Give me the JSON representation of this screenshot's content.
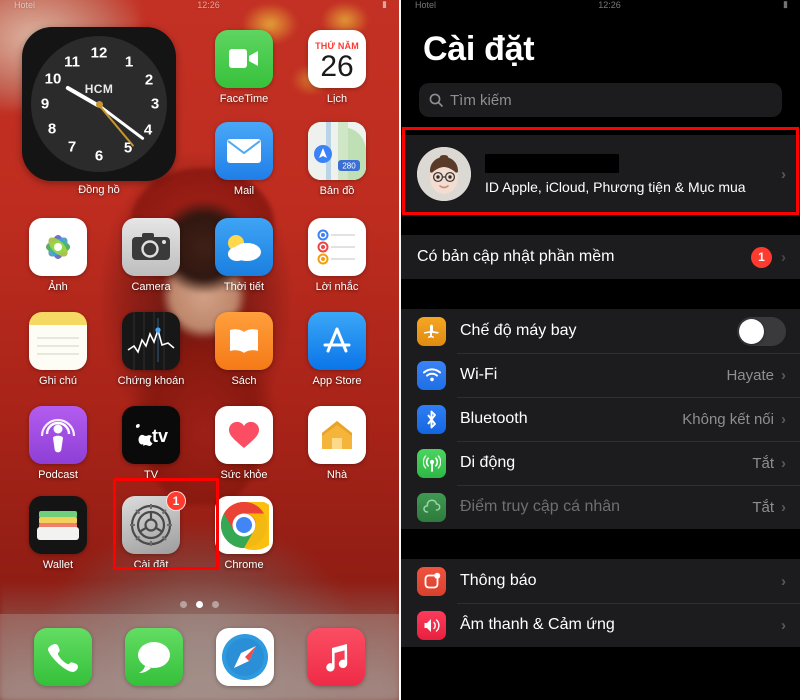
{
  "left_screen": {
    "name": "ios-home-screen",
    "statusbar": {
      "carrier": "Hotel",
      "time": "12:26",
      "battery": ""
    },
    "clock_widget": {
      "city": "HCM",
      "label": "Đồng hồ",
      "numbers": [
        "12",
        "1",
        "2",
        "3",
        "4",
        "5",
        "6",
        "7",
        "8",
        "9",
        "10",
        "11"
      ]
    },
    "apps": [
      {
        "label": "FaceTime",
        "icon": "facetime-icon"
      },
      {
        "label": "Lịch",
        "icon": "calendar-icon",
        "cal_weekday": "THỨ NĂM",
        "cal_day": "26"
      },
      {
        "label": "Mail",
        "icon": "mail-icon"
      },
      {
        "label": "Bản đồ",
        "icon": "maps-icon",
        "route": "280"
      },
      {
        "label": "Ảnh",
        "icon": "photos-icon"
      },
      {
        "label": "Camera",
        "icon": "camera-icon"
      },
      {
        "label": "Thời tiết",
        "icon": "weather-icon"
      },
      {
        "label": "Lời nhắc",
        "icon": "reminders-icon"
      },
      {
        "label": "Ghi chú",
        "icon": "notes-icon"
      },
      {
        "label": "Chứng khoán",
        "icon": "stocks-icon"
      },
      {
        "label": "Sách",
        "icon": "books-icon"
      },
      {
        "label": "App Store",
        "icon": "appstore-icon"
      },
      {
        "label": "Podcast",
        "icon": "podcast-icon"
      },
      {
        "label": "TV",
        "icon": "tv-icon"
      },
      {
        "label": "Sức khỏe",
        "icon": "health-icon"
      },
      {
        "label": "Nhà",
        "icon": "home-icon"
      },
      {
        "label": "Wallet",
        "icon": "wallet-icon"
      },
      {
        "label": "Cài đặt",
        "icon": "settings-gear-icon",
        "badge": "1",
        "highlighted": true
      },
      {
        "label": "Chrome",
        "icon": "chrome-icon"
      }
    ],
    "dock": [
      {
        "label": "Điện thoại",
        "icon": "phone-icon"
      },
      {
        "label": "Tin nhắn",
        "icon": "messages-icon"
      },
      {
        "label": "Safari",
        "icon": "safari-icon"
      },
      {
        "label": "Nhạc",
        "icon": "music-icon"
      }
    ],
    "page_dots": {
      "count": 3,
      "active_index": 1
    },
    "highlight_color": "#ff0000"
  },
  "right_screen": {
    "name": "ios-settings-screen",
    "statusbar": {
      "carrier": "Hotel",
      "time": "12:26",
      "battery": ""
    },
    "title": "Cài đặt",
    "search": {
      "placeholder": "Tìm kiếm",
      "icon": "search-icon"
    },
    "account": {
      "name_redacted": true,
      "subtitle": "ID Apple, iCloud, Phương tiện & Mục mua",
      "avatar": "memoji-avatar",
      "highlighted": true
    },
    "update_row": {
      "label": "Có bản cập nhật phần mềm",
      "badge": "1"
    },
    "connectivity": [
      {
        "label": "Chế độ máy bay",
        "icon": "airplane-icon",
        "control": "toggle",
        "toggle_on": false
      },
      {
        "label": "Wi-Fi",
        "icon": "wifi-icon",
        "value": "Hayate"
      },
      {
        "label": "Bluetooth",
        "icon": "bluetooth-icon",
        "value": "Không kết nối"
      },
      {
        "label": "Di động",
        "icon": "cellular-icon",
        "value": "Tắt"
      },
      {
        "label": "Điểm truy cập cá nhân",
        "icon": "hotspot-icon",
        "value": "Tắt",
        "dimmed": true
      }
    ],
    "notifications_group": [
      {
        "label": "Thông báo",
        "icon": "notifications-icon"
      },
      {
        "label": "Âm thanh & Cảm ứng",
        "icon": "sounds-icon"
      }
    ],
    "accent_colors": {
      "badge_red": "#ff3b30",
      "highlight_red": "#ff0000",
      "group_bg": "#1c1c1e",
      "page_bg": "#000000"
    }
  }
}
